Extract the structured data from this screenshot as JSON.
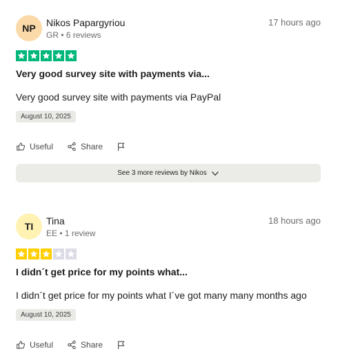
{
  "reviews": [
    {
      "initials": "NP",
      "avatar_color": "#fbd9a8",
      "name": "Nikos Papargyriou",
      "meta": "GR • 6 reviews",
      "time": "17 hours ago",
      "rating": 5,
      "star_color": "#00b67a",
      "title": "Very good survey site with payments via...",
      "body": "Very good survey site with payments via PayPal",
      "date": "August 10, 2025",
      "useful_label": "Useful",
      "share_label": "Share"
    },
    {
      "initials": "TI",
      "avatar_color": "#fff2b3",
      "name": "Tina",
      "meta": "EE • 1 review",
      "time": "18 hours ago",
      "rating": 3,
      "star_color": "#ffce00",
      "title": "I didn´t get price for my points what...",
      "body": "I didn´t get price for my points what I´ve got many many months ago",
      "date": "August 10, 2025",
      "useful_label": "Useful",
      "share_label": "Share"
    }
  ],
  "more_button": {
    "label": "See 3 more reviews by Nikos"
  },
  "empty_star_color": "#dcdce6"
}
